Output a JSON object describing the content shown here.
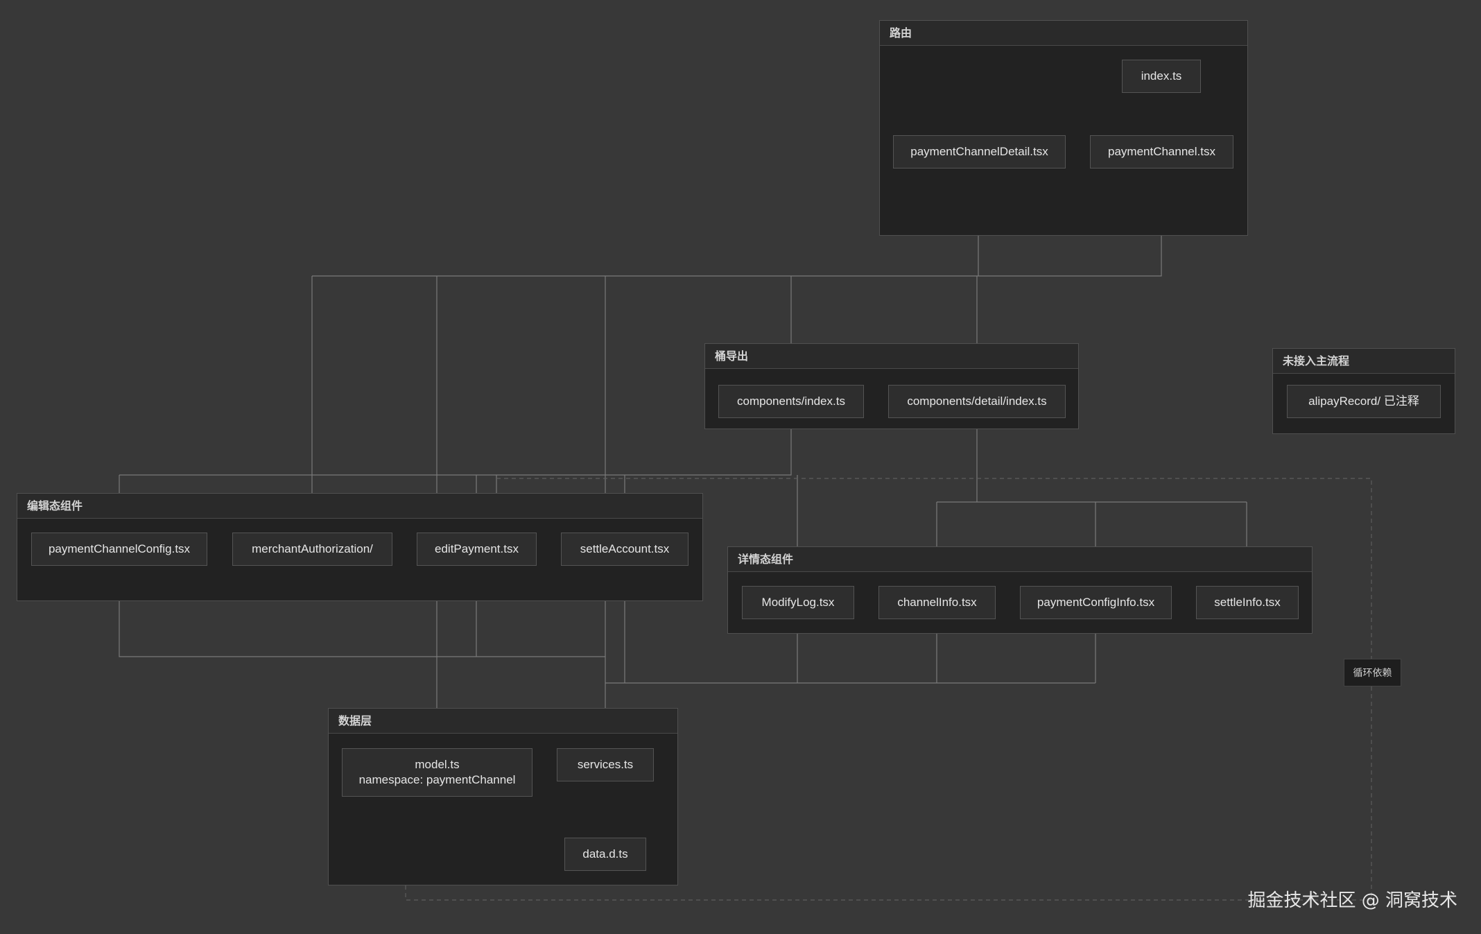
{
  "groups": {
    "routing": {
      "title": "路由"
    },
    "barrel": {
      "title": "桶导出"
    },
    "unused": {
      "title": "未接入主流程"
    },
    "edit": {
      "title": "编辑态组件"
    },
    "detail": {
      "title": "详情态组件"
    },
    "data": {
      "title": "数据层"
    }
  },
  "nodes": {
    "index_ts": "index.ts",
    "payment_channel_detail": "paymentChannelDetail.tsx",
    "payment_channel": "paymentChannel.tsx",
    "components_index": "components/index.ts",
    "components_detail_index": "components/detail/index.ts",
    "alipay_record": "alipayRecord/ 已注释",
    "payment_channel_config": "paymentChannelConfig.tsx",
    "merchant_authorization": "merchantAuthorization/",
    "edit_payment": "editPayment.tsx",
    "settle_account": "settleAccount.tsx",
    "modify_log": "ModifyLog.tsx",
    "channel_info": "channelInfo.tsx",
    "payment_config_info": "paymentConfigInfo.tsx",
    "settle_info": "settleInfo.tsx",
    "model_ts_line1": "model.ts",
    "model_ts_line2": "namespace: paymentChannel",
    "services_ts": "services.ts",
    "data_d_ts": "data.d.ts"
  },
  "circular_label": "循环依赖",
  "watermark": "掘金技术社区 @ 洞窝技术",
  "colors": {
    "background": "#383838",
    "group_fill": "#222222",
    "node_fill": "#2e2e2e",
    "edge": "#7a7a7a",
    "arrow": "#3aa6e0"
  }
}
